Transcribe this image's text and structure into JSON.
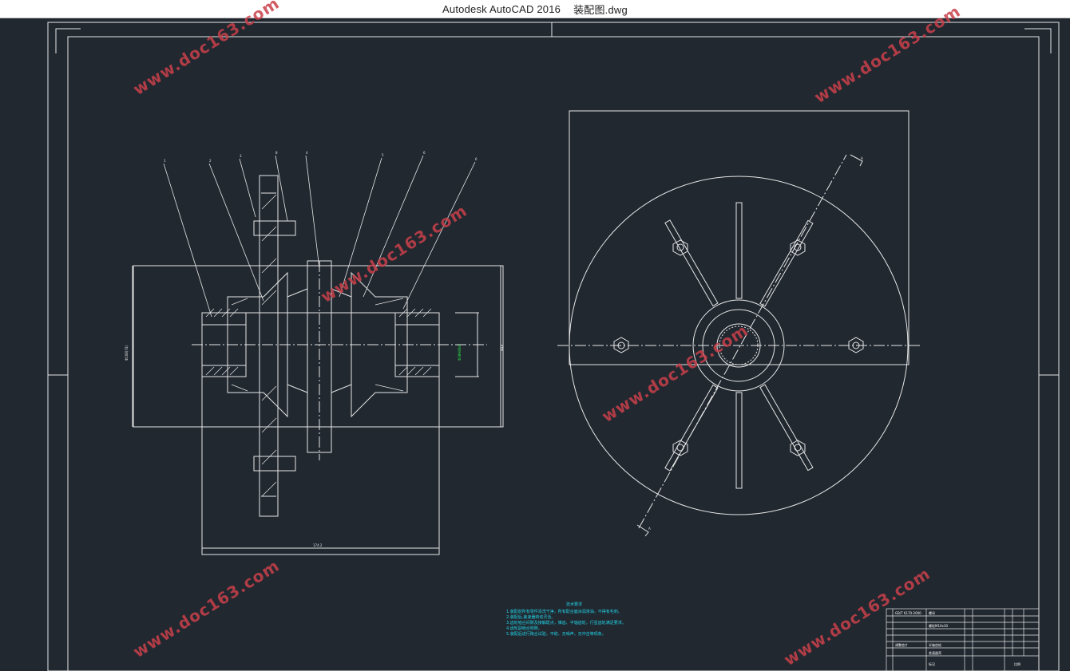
{
  "window": {
    "app_title": "Autodesk AutoCAD 2016",
    "file_name": "装配图.dwg"
  },
  "drawing": {
    "left_view": {
      "part_callouts": [
        "1",
        "2",
        "3",
        "8",
        "4",
        "5",
        "6",
        "6"
      ],
      "dim_overall_length": "174.2",
      "dim_height": "Φ108(74)",
      "dim_bore": "Φ38H8/k6",
      "dim_flange": "Φ48"
    },
    "right_view": {
      "section_label_top": "A",
      "section_label_bottom": "A"
    },
    "tech_requirements": {
      "title": "技术要求",
      "items": [
        "1.装配前所有零件清洗干净，所有配合面涂润滑油，不得有毛刺。",
        "2.装配后,差速器转动灵活。",
        "3.齿轮啮合间隙及接触斑点，锥齿、半轴齿轮，行星齿轮满足要求。",
        "4.齿轮副啮合侧隙。",
        "5.装配后进行跑合试验，平稳、无噪声，无冲击等现象。"
      ]
    },
    "title_block": {
      "rows": [
        "GB/T 6170-2000",
        "螺母",
        "螺栓M10x30",
        "调整垫片",
        "半轴齿轮",
        "差速器壳",
        "标记",
        "比例"
      ]
    }
  },
  "watermark_text": "www.doc163.com",
  "colors": {
    "background": "#212830",
    "line": "#e6e6e6",
    "cyan_text": "#22d3e6",
    "green_text": "#2ee84a",
    "watermark": "#c9404a"
  }
}
